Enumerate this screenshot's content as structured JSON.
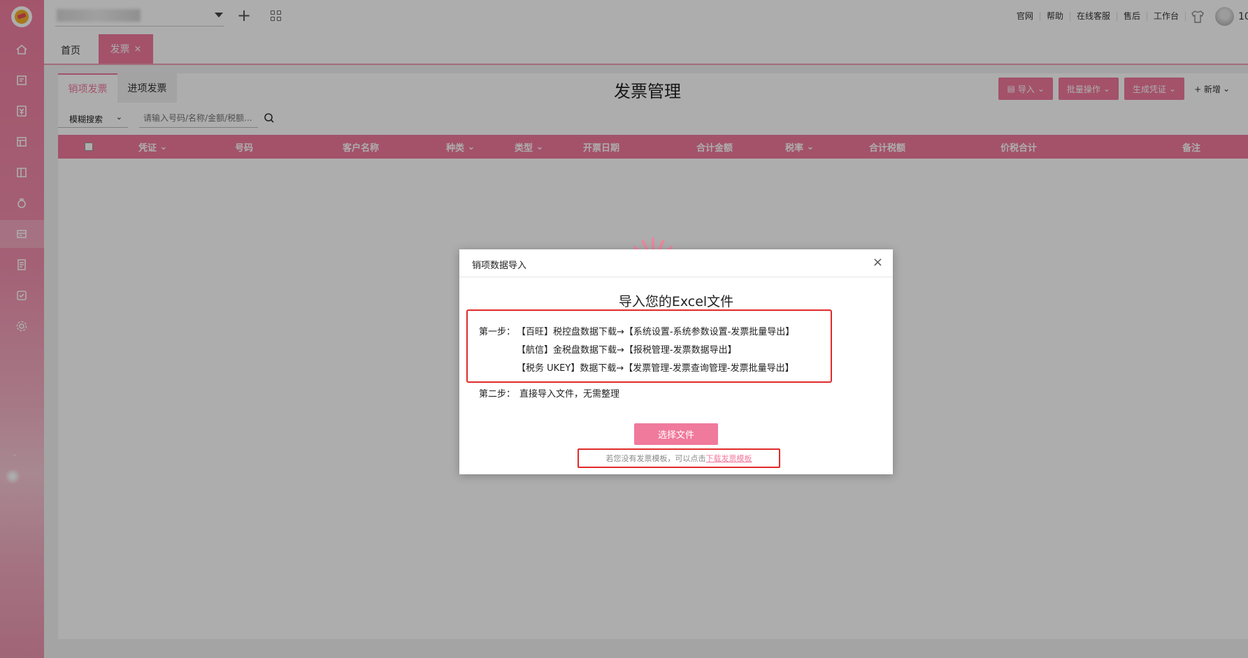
{
  "topbar": {
    "links": [
      "官网",
      "帮助",
      "在线客服",
      "售后",
      "工作台"
    ],
    "user_number": "10"
  },
  "tabs": {
    "home": "首页",
    "active": "发票",
    "close": "×"
  },
  "invoice_tabs": [
    "销项发票",
    "进项发票"
  ],
  "page_title": "发票管理",
  "actions": {
    "import": "导入",
    "batch": "批量操作",
    "voucher": "生成凭证",
    "new": "+ 新增"
  },
  "search": {
    "mode": "模糊搜索",
    "placeholder": "请输入号码/名称/金额/税额..."
  },
  "table": {
    "columns": [
      "凭证",
      "号码",
      "客户名称",
      "种类",
      "类型",
      "开票日期",
      "合计金额",
      "税率",
      "合计税额",
      "价税合计",
      "备注"
    ]
  },
  "dialog": {
    "title": "销项数据导入",
    "close": "×",
    "heading": "导入您的Excel文件",
    "step1_label": "第一步：",
    "step1_lines": [
      "【百旺】税控盘数据下载→【系统设置-系统参数设置-发票批量导出】",
      "【航信】金税盘数据下载→【报税管理-发票数据导出】",
      "【税务 UKEY】数据下载→【发票管理-发票查询管理-发票批量导出】"
    ],
    "step2_label": "第二步：",
    "step2_text": "直接导入文件，无需整理",
    "choose_button": "选择文件",
    "tip_text": "若您没有发票模板，可以点击",
    "tip_link": "下载发票模板"
  }
}
